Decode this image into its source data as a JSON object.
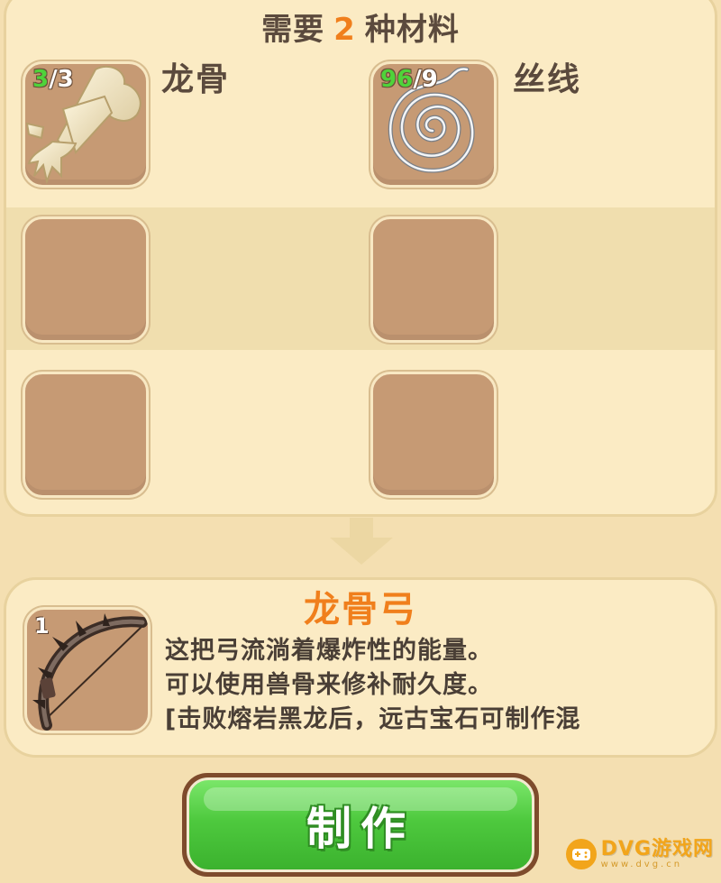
{
  "materials": {
    "title_prefix": "需要",
    "title_count": "2",
    "title_suffix": "种材料",
    "items": [
      {
        "name": "龙骨",
        "have": "3",
        "need": "/3",
        "icon": "dragon-bone-icon"
      },
      {
        "name": "丝线",
        "have": "96",
        "need": "/9",
        "icon": "thread-coil-icon"
      }
    ]
  },
  "result": {
    "name": "龙骨弓",
    "quantity": "1",
    "icon": "bone-bow-icon",
    "description": [
      "这把弓流淌着爆炸性的能量。",
      "可以使用兽骨来修补耐久度。",
      "[击败熔岩黑龙后，远古宝石可制作混"
    ]
  },
  "craft_button": {
    "label": "制作"
  },
  "watermark": {
    "brand": "DVG游戏网",
    "domain": "www.dvg.cn"
  },
  "colors": {
    "accent_orange": "#f07f1c",
    "have_green": "#4fd33a",
    "button_green": "#4ec93e",
    "slot_brown": "#c69a74"
  }
}
